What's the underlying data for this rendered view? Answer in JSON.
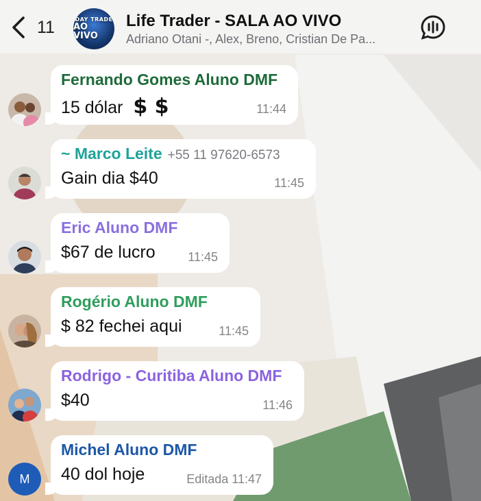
{
  "header": {
    "back_count": "11",
    "group_title": "Life Trader - SALA AO VIVO",
    "group_members": "Adriano Otani -, Alex, Breno, Cristian De Pa...",
    "avatar_text_1": "DAY TRADE",
    "avatar_text_2": "AO VIVO"
  },
  "messages": [
    {
      "sender": "Fernando Gomes Aluno DMF",
      "sender_color": "#1e6b3a",
      "text": "15 dólar",
      "emoji": "$ $",
      "time": "11:44"
    },
    {
      "sender": "~ Marco Leite",
      "phone": "+55 11 97620-6573",
      "sender_color": "#1fa398",
      "text": "Gain dia $40",
      "time": "11:45"
    },
    {
      "sender": "Eric Aluno DMF",
      "sender_color": "#8a6fe0",
      "text": "$67 de lucro",
      "time": "11:45"
    },
    {
      "sender": "Rogério Aluno DMF",
      "sender_color": "#2e9e5c",
      "text": "$ 82 fechei aqui",
      "time": "11:45"
    },
    {
      "sender": "Rodrigo - Curitiba Aluno DMF",
      "sender_color": "#8b63df",
      "text": "$40",
      "time": "11:46"
    },
    {
      "sender": "Michel Aluno DMF",
      "sender_color": "#1c57a6",
      "text": "40 dol hoje",
      "edited": "Editada",
      "time": "11:47",
      "avatar_letter": "M"
    }
  ]
}
